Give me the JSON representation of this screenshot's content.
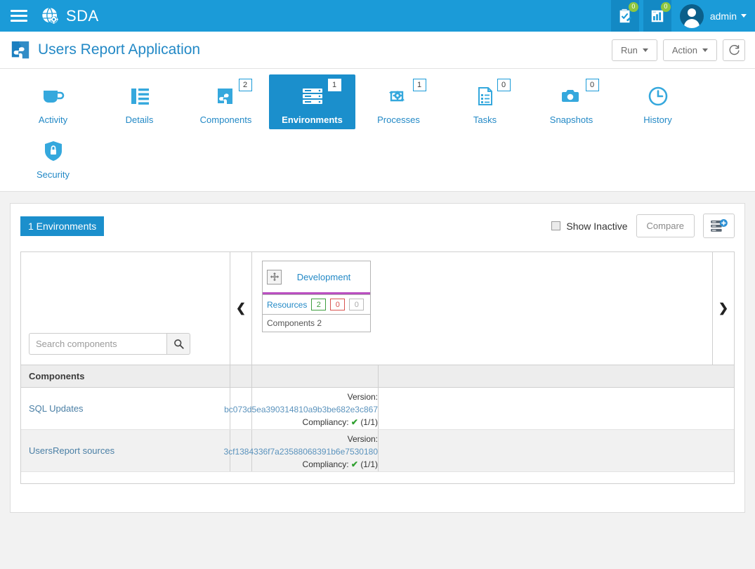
{
  "topbar": {
    "menu_icon": "hamburger-icon",
    "brand": "SDA",
    "brand_icon": "globe-gear-icon",
    "approvals_icon": "clipboard-check-icon",
    "approvals_badge": "0",
    "reports_icon": "chart-report-icon",
    "reports_badge": "0",
    "avatar_icon": "user-avatar",
    "user": "admin",
    "user_caret": "caret-down-icon"
  },
  "appheader": {
    "icon": "puzzle-piece-icon",
    "title": "Users Report Application",
    "run_label": "Run",
    "action_label": "Action",
    "refresh_icon": "refresh-icon"
  },
  "tabs": [
    {
      "label": "Activity",
      "icon": "coffee-cup-icon",
      "badge": null,
      "active": false
    },
    {
      "label": "Details",
      "icon": "list-detail-icon",
      "badge": null,
      "active": false
    },
    {
      "label": "Components",
      "icon": "puzzle-piece-icon",
      "badge": "2",
      "active": false
    },
    {
      "label": "Environments",
      "icon": "server-stack-icon",
      "badge": "1",
      "active": true
    },
    {
      "label": "Processes",
      "icon": "process-gear-icon",
      "badge": "1",
      "active": false
    },
    {
      "label": "Tasks",
      "icon": "task-list-icon",
      "badge": "0",
      "active": false
    },
    {
      "label": "Snapshots",
      "icon": "camera-icon",
      "badge": "0",
      "active": false
    },
    {
      "label": "History",
      "icon": "clock-icon",
      "badge": null,
      "active": false
    },
    {
      "label": "Security",
      "icon": "shield-lock-icon",
      "badge": null,
      "active": false
    }
  ],
  "panel": {
    "count_pill": "1 Environments",
    "show_inactive_label": "Show Inactive",
    "show_inactive_checked": false,
    "compare_label": "Compare",
    "add_env_icon": "add-environment-icon",
    "prev_arrow": "❮",
    "next_arrow": "❯",
    "search_placeholder": "Search components",
    "search_value": "",
    "search_icon": "search-icon",
    "components_header": "Components"
  },
  "environments": [
    {
      "name": "Development",
      "drag_icon": "move-arrows-icon",
      "resources_label": "Resources",
      "resources_ok": "2",
      "resources_error": "0",
      "resources_other": "0",
      "components_label": "Components 2",
      "accent_color": "#b94fc0"
    }
  ],
  "components": [
    {
      "name": "SQL Updates",
      "version_label": "Version:",
      "version": "bc073d5ea390314810a9b3be682e3c867",
      "compliancy_label": "Compliancy:",
      "compliancy_icon": "check-icon",
      "compliancy_value": "(1/1)"
    },
    {
      "name": "UsersReport sources",
      "version_label": "Version:",
      "version": "3cf1384336f7a23588068391b6e7530180",
      "compliancy_label": "Compliancy:",
      "compliancy_icon": "check-icon",
      "compliancy_value": "(1/1)"
    }
  ],
  "colors": {
    "brand_blue": "#1b9bd8",
    "tab_active": "#1b8fcc",
    "link_blue": "#2389c6",
    "badge_green": "#8dc63f",
    "ok_green": "#3f9e3f",
    "error_red": "#d9534f",
    "env_accent": "#b94fc0"
  }
}
